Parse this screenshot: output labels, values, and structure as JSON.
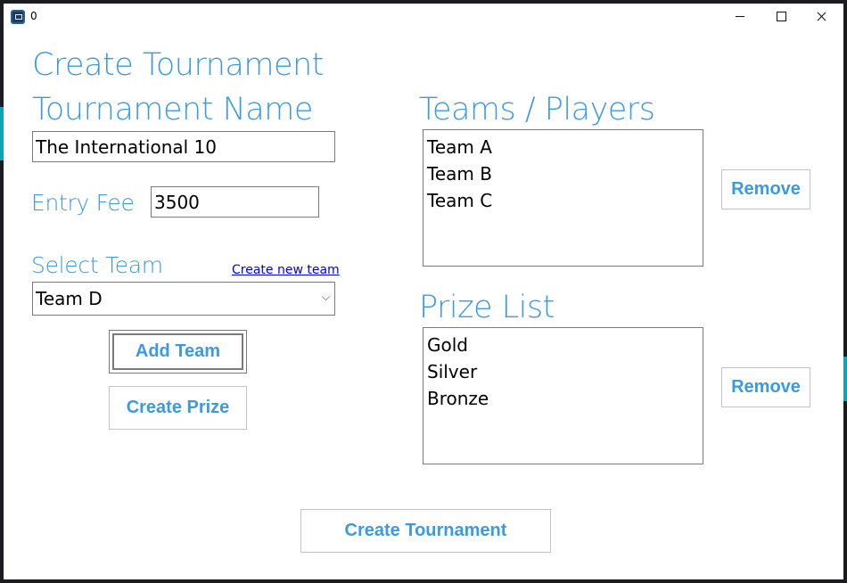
{
  "window": {
    "title": "0"
  },
  "titlebar": {
    "minimize": "minimize",
    "maximize": "maximize",
    "close": "close"
  },
  "form": {
    "heading": "Create Tournament",
    "tournament_name_label": "Tournament Name",
    "tournament_name_value": "The International 10",
    "entry_fee_label": "Entry Fee",
    "entry_fee_value": "3500",
    "select_team_label": "Select Team",
    "create_new_team_link": "Create new team",
    "selected_team": "Team D",
    "add_team_button": "Add Team",
    "create_prize_button": "Create Prize",
    "create_tournament_button": "Create Tournament"
  },
  "teams_panel": {
    "label": "Teams / Players",
    "items": [
      "Team A",
      "Team B",
      "Team C"
    ],
    "remove_button": "Remove"
  },
  "prizes_panel": {
    "label": "Prize List",
    "items": [
      "Gold",
      "Silver",
      "Bronze"
    ],
    "remove_button": "Remove"
  },
  "colors": {
    "accent": "#3b9ae1",
    "link": "#0000ee",
    "border": "#7a7a7a",
    "button_border": "#c4c4c4"
  }
}
